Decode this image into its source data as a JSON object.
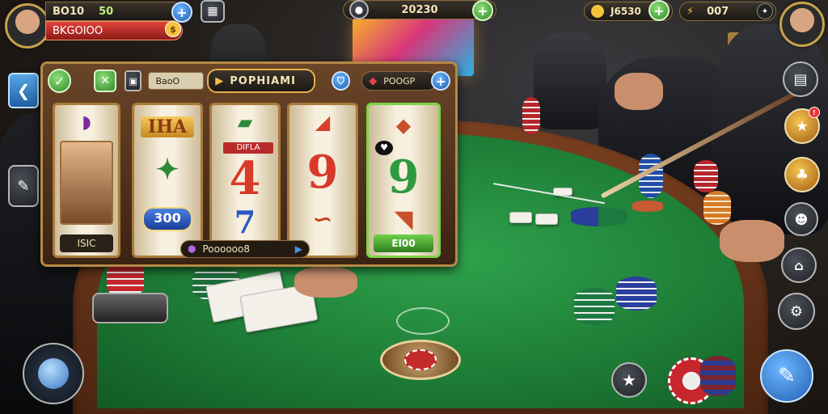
{
  "hud_top_left": {
    "player_name": "BO10",
    "score": "50",
    "status": "BKGOIOO"
  },
  "hud_top_center": {
    "balance": "20230"
  },
  "hud_top_right": {
    "coins": "J6530",
    "gems": "007"
  },
  "slot_panel": {
    "title": "POPHIAMI",
    "right_label": "POOGP",
    "reel1_label": "ISIC",
    "reel2_banner": "IHA",
    "reel2_value": "300",
    "reel3_text": "DIFLA",
    "reel3_number": "4",
    "reel4_number": "9",
    "reel5_number": "9",
    "reel5_label": "EI00",
    "bottom_label": "Poooooo8"
  },
  "icons": [
    "back-arrow-icon",
    "wrench-icon",
    "notebook-icon",
    "star-icon",
    "pencil-icon",
    "joystick-icon",
    "plus-icon",
    "shield-icon",
    "bell-icon",
    "settings-icon"
  ],
  "colors": {
    "felt": "#1e7d36",
    "rail": "#6a3818",
    "gold": "#c9a24a",
    "accent_blue": "#1f5fb3",
    "accent_green": "#2f8a2a"
  }
}
